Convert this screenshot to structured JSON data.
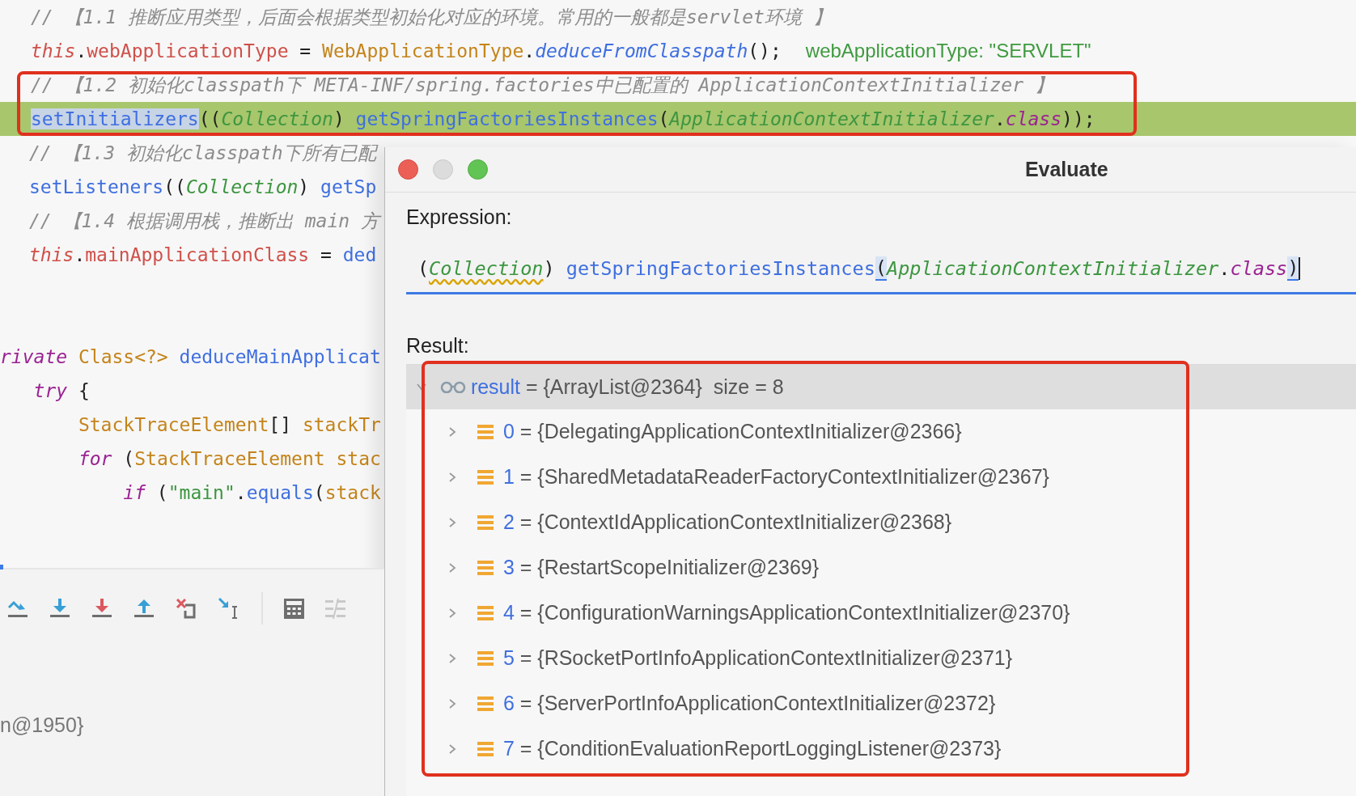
{
  "editor": {
    "top_lines": [
      {
        "highlighted": false,
        "tokens": [
          {
            "kind": "c",
            "t": "// 【1.1 推断应用类型，后面会根据类型初始化对应的环境。常用的一般都是servlet环境 】"
          }
        ]
      },
      {
        "highlighted": false,
        "tokens": [
          {
            "kind": "kw",
            "t": "this"
          },
          {
            "kind": "p",
            "t": "."
          },
          {
            "kind": "fld",
            "t": "webApplicationType"
          },
          {
            "kind": "p",
            "t": " = "
          },
          {
            "kind": "typ",
            "t": "WebApplicationType"
          },
          {
            "kind": "p",
            "t": "."
          },
          {
            "kind": "mi",
            "t": "deduceFromClasspath"
          },
          {
            "kind": "p",
            "t": "();"
          }
        ],
        "hint": "webApplicationType: \"SERVLET\""
      },
      {
        "highlighted": false,
        "tokens": [
          {
            "kind": "c",
            "t": "// 【1.2 初始化classpath下 META-INF/spring.factories中已配置的 ApplicationContextInitializer 】"
          }
        ]
      },
      {
        "highlighted": true,
        "tokens": [
          {
            "kind": "msel",
            "t": "setInitializers"
          },
          {
            "kind": "p",
            "t": "(("
          },
          {
            "kind": "cast",
            "t": "Collection"
          },
          {
            "kind": "p",
            "t": ") "
          },
          {
            "kind": "m",
            "t": "getSpringFactoriesInstances"
          },
          {
            "kind": "p",
            "t": "("
          },
          {
            "kind": "cast",
            "t": "ApplicationContextInitializer"
          },
          {
            "kind": "p",
            "t": "."
          },
          {
            "kind": "cls",
            "t": "class"
          },
          {
            "kind": "p",
            "t": "));"
          }
        ]
      }
    ],
    "side_lines": [
      {
        "highlighted": false,
        "tokens": [
          {
            "kind": "c",
            "t": "// 【1.3 初始化classpath下所有已配"
          }
        ]
      },
      {
        "highlighted": false,
        "tokens": [
          {
            "kind": "m",
            "t": "setListeners"
          },
          {
            "kind": "p",
            "t": "(("
          },
          {
            "kind": "cast",
            "t": "Collection"
          },
          {
            "kind": "p",
            "t": ") "
          },
          {
            "kind": "m",
            "t": "getSp"
          }
        ]
      },
      {
        "highlighted": false,
        "tokens": [
          {
            "kind": "c",
            "t": "// 【1.4 根据调用栈，推断出 main 方"
          }
        ]
      },
      {
        "highlighted": false,
        "tokens": [
          {
            "kind": "kw",
            "t": "this"
          },
          {
            "kind": "p",
            "t": "."
          },
          {
            "kind": "fld",
            "t": "mainApplicationClass"
          },
          {
            "kind": "p",
            "t": " = "
          },
          {
            "kind": "m",
            "t": "ded"
          }
        ]
      }
    ],
    "method_lines": [
      {
        "highlighted": false,
        "tokens": [
          {
            "kind": "kw2",
            "t": "rivate "
          },
          {
            "kind": "typ",
            "t": "Class<?> "
          },
          {
            "kind": "m",
            "t": "deduceMainApplicat"
          }
        ]
      },
      {
        "highlighted": false,
        "tokens": [
          {
            "kind": "kw2",
            "t": "   try"
          },
          {
            "kind": "p",
            "t": " {"
          }
        ]
      },
      {
        "highlighted": false,
        "tokens": [
          {
            "kind": "typ",
            "t": "       StackTraceElement"
          },
          {
            "kind": "p",
            "t": "[] "
          },
          {
            "kind": "typ",
            "t": "stackTr"
          }
        ]
      },
      {
        "highlighted": false,
        "tokens": [
          {
            "kind": "kw2",
            "t": "       for"
          },
          {
            "kind": "p",
            "t": " ("
          },
          {
            "kind": "typ",
            "t": "StackTraceElement stac"
          }
        ]
      },
      {
        "highlighted": false,
        "tokens": [
          {
            "kind": "kw2",
            "t": "           if"
          },
          {
            "kind": "p",
            "t": " ("
          },
          {
            "kind": "str",
            "t": "\"main\""
          },
          {
            "kind": "p",
            "t": "."
          },
          {
            "kind": "m",
            "t": "equals"
          },
          {
            "kind": "p",
            "t": "("
          },
          {
            "kind": "typ",
            "t": "stack"
          }
        ]
      }
    ]
  },
  "variables_fragment": "n@1950}",
  "dialog": {
    "title": "Evaluate",
    "expression_label": "Expression:",
    "expression": [
      {
        "kind": "p",
        "t": "("
      },
      {
        "kind": "warn",
        "t": "Collection"
      },
      {
        "kind": "p",
        "t": ") "
      },
      {
        "kind": "m",
        "t": "getSpringFactoriesInstances"
      },
      {
        "kind": "bm",
        "t": "("
      },
      {
        "kind": "cast",
        "t": "ApplicationContextInitializer"
      },
      {
        "kind": "p",
        "t": "."
      },
      {
        "kind": "cls",
        "t": "class"
      },
      {
        "kind": "bm",
        "t": ")"
      }
    ],
    "result_label": "Result:",
    "result": {
      "name": "result",
      "value": "= {ArrayList@2364}",
      "size": "size = 8",
      "expanded": true,
      "selected": true,
      "children": [
        {
          "name": "0",
          "value": "= {DelegatingApplicationContextInitializer@2366}",
          "expanded": false,
          "selected": false
        },
        {
          "name": "1",
          "value": "= {SharedMetadataReaderFactoryContextInitializer@2367}",
          "expanded": false,
          "selected": false
        },
        {
          "name": "2",
          "value": "= {ContextIdApplicationContextInitializer@2368}",
          "expanded": false,
          "selected": false
        },
        {
          "name": "3",
          "value": "= {RestartScopeInitializer@2369}",
          "expanded": false,
          "selected": false
        },
        {
          "name": "4",
          "value": "= {ConfigurationWarningsApplicationContextInitializer@2370}",
          "expanded": false,
          "selected": false
        },
        {
          "name": "5",
          "value": "= {RSocketPortInfoApplicationContextInitializer@2371}",
          "expanded": false,
          "selected": false
        },
        {
          "name": "6",
          "value": "= {ServerPortInfoApplicationContextInitializer@2372}",
          "expanded": false,
          "selected": false
        },
        {
          "name": "7",
          "value": "= {ConditionEvaluationReportLoggingListener@2373}",
          "expanded": false,
          "selected": false
        }
      ]
    }
  }
}
